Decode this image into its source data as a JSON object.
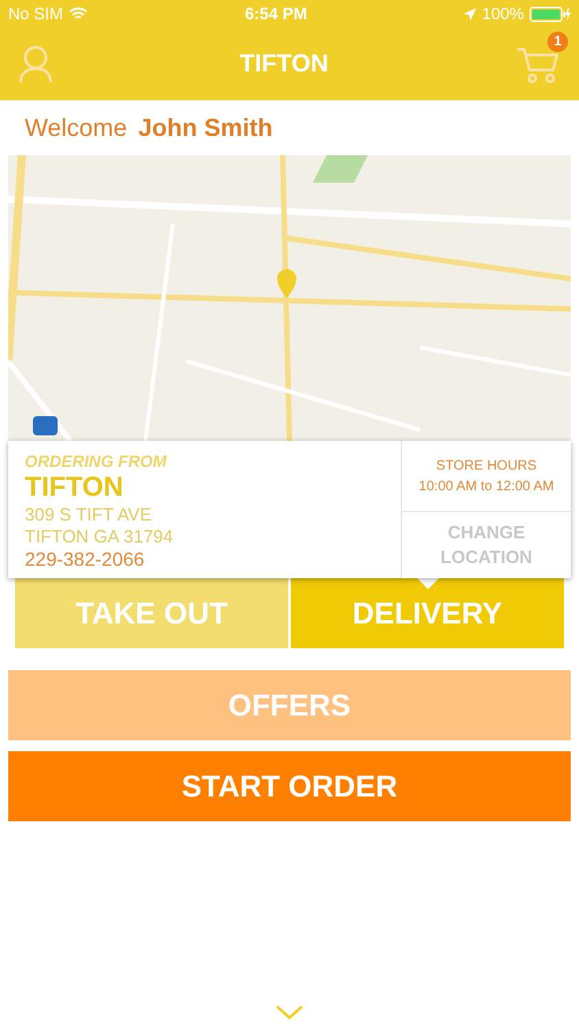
{
  "status_bar": {
    "carrier": "No SIM",
    "time": "6:54 PM",
    "battery": "100%"
  },
  "nav": {
    "title": "TIFTON",
    "cart_count": "1"
  },
  "welcome": {
    "label": "Welcome",
    "name": "John Smith"
  },
  "store": {
    "heading": "ORDERING FROM",
    "name": "TIFTON",
    "address_1": "309 S TIFT AVE",
    "address_2": "TIFTON GA 31794",
    "phone": "229-382-2066",
    "hours_label": "STORE HOURS",
    "hours": "10:00 AM to 12:00 AM",
    "change": "CHANGE LOCATION"
  },
  "tabs": [
    {
      "label": "TAKE OUT",
      "selected": false
    },
    {
      "label": "DELIVERY",
      "selected": true
    }
  ],
  "buttons": [
    {
      "label": "OFFERS",
      "kind": "light"
    },
    {
      "label": "START ORDER",
      "kind": "strong"
    }
  ]
}
